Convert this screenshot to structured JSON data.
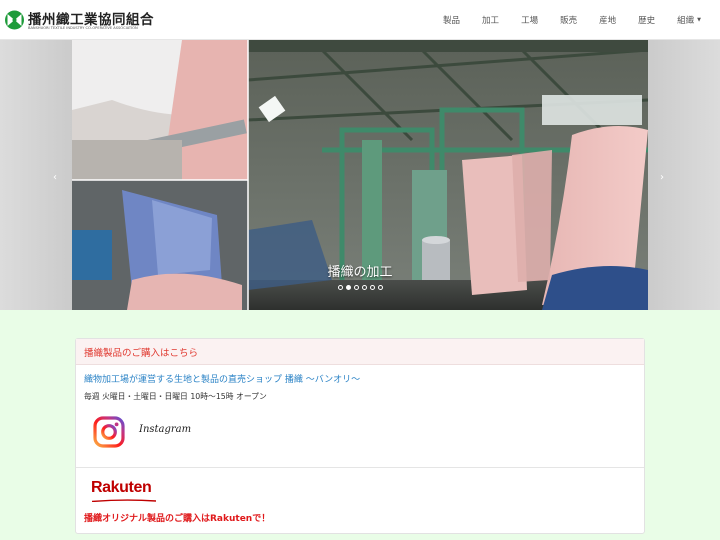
{
  "brand": {
    "title": "播州織工業協同組合",
    "subtitle": "BANSHUORI TEXTILE INDUSTRY CO-OPERATIVE ASSOCIATION",
    "logo_icon": "banshu-logo-icon",
    "logo_color": "#1e9b3a"
  },
  "nav": {
    "items": [
      "製品",
      "加工",
      "工場",
      "販売",
      "産地",
      "歴史"
    ],
    "dropdown_label": "組織",
    "caret": "▼"
  },
  "carousel": {
    "caption": "播織の加工",
    "prev_symbol": "‹",
    "next_symbol": "›",
    "slide_count": 6,
    "active_index": 1
  },
  "panel": {
    "heading": "播織製品のご購入はこちら",
    "shop_link": "織物加工場が運営する生地と製品の直売ショップ 播織 〜バンオリ〜",
    "hours": "毎週 火曜日・土曜日・日曜日 10時〜15時 オープン",
    "instagram_label": "Instagram",
    "rakuten_logo": "Rakuten",
    "rakuten_note": "播織オリジナル製品のご購入はRakutenで！"
  },
  "colors": {
    "page_bg": "#e9fde7",
    "heading_red": "#e0382f",
    "link_blue": "#2b83c6",
    "rakuten_red": "#bf0000"
  }
}
